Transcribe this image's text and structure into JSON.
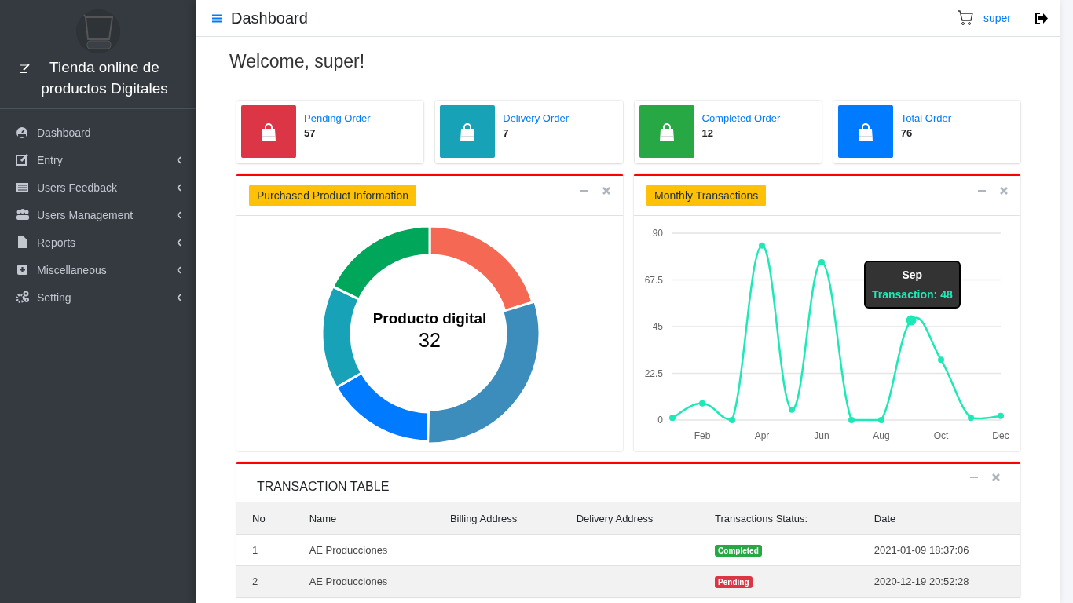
{
  "sidebar": {
    "brand": "Tienda online de productos Digitales",
    "items": [
      {
        "label": "Dashboard",
        "has_submenu": false
      },
      {
        "label": "Entry",
        "has_submenu": true
      },
      {
        "label": "Users Feedback",
        "has_submenu": true
      },
      {
        "label": "Users Management",
        "has_submenu": true
      },
      {
        "label": "Reports",
        "has_submenu": true
      },
      {
        "label": "Miscellaneous",
        "has_submenu": true
      },
      {
        "label": "Setting",
        "has_submenu": true
      }
    ]
  },
  "topbar": {
    "title": "Dashboard",
    "user": "super"
  },
  "welcome": "Welcome, super!",
  "stats": [
    {
      "label": "Pending Order",
      "value": "57",
      "color": "#dc3545"
    },
    {
      "label": "Delivery Order",
      "value": "7",
      "color": "#17a2b8"
    },
    {
      "label": "Completed Order",
      "value": "12",
      "color": "#28a745"
    },
    {
      "label": "Total Order",
      "value": "76",
      "color": "#007bff"
    }
  ],
  "product_panel": {
    "title": "Purchased Product Information",
    "center_label": "Producto digital",
    "center_value": "32"
  },
  "transactions_panel": {
    "title": "Monthly Transactions",
    "tooltip_title": "Sep",
    "chart_data": {
      "type": "line",
      "categories": [
        null,
        "Feb",
        null,
        "Apr",
        null,
        "Jun",
        null,
        "Aug",
        null,
        "Oct",
        null,
        "Dec"
      ],
      "series": [
        {
          "color": "#1de9b6",
          "marker": "circle",
          "values": [
            1,
            8,
            0,
            84,
            5,
            76,
            0,
            0,
            48,
            29,
            1,
            2
          ]
        }
      ],
      "ylim": [
        0,
        90
      ],
      "yticks": [
        0,
        22.5,
        45,
        67.5,
        90
      ],
      "grid": true,
      "annotations": [
        {
          "y": 48,
          "text": "Transaction: 48"
        }
      ]
    }
  },
  "table": {
    "title": "TRANSACTION TABLE",
    "columns": [
      "No",
      "Name",
      "Billing Address",
      "Delivery Address",
      "Transactions Status:",
      "Date"
    ],
    "rows": [
      {
        "no": "1",
        "name": "AE Producciones",
        "status": "Completed",
        "kind": "completed",
        "date": "2021-01-09 18:37:06"
      },
      {
        "no": "2",
        "name": "AE Producciones",
        "status": "Pending",
        "kind": "pending",
        "date": "2020-12-19 20:52:28"
      }
    ]
  }
}
